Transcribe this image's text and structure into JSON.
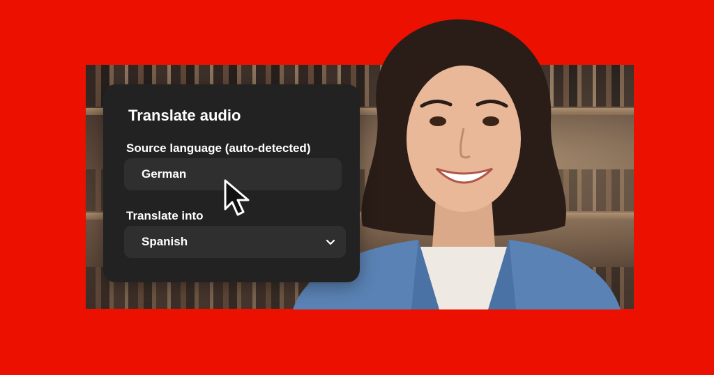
{
  "dialog": {
    "title": "Translate audio",
    "source_label": "Source language (auto-detected)",
    "source_value": "German",
    "target_label": "Translate into",
    "target_value": "Spanish"
  },
  "icons": {
    "dropdown": "chevron-down-icon",
    "pointer": "mouse-pointer-icon"
  },
  "colors": {
    "background": "#eb1000",
    "card": "#222222",
    "field": "#2f2f2f",
    "text": "#ffffff"
  }
}
